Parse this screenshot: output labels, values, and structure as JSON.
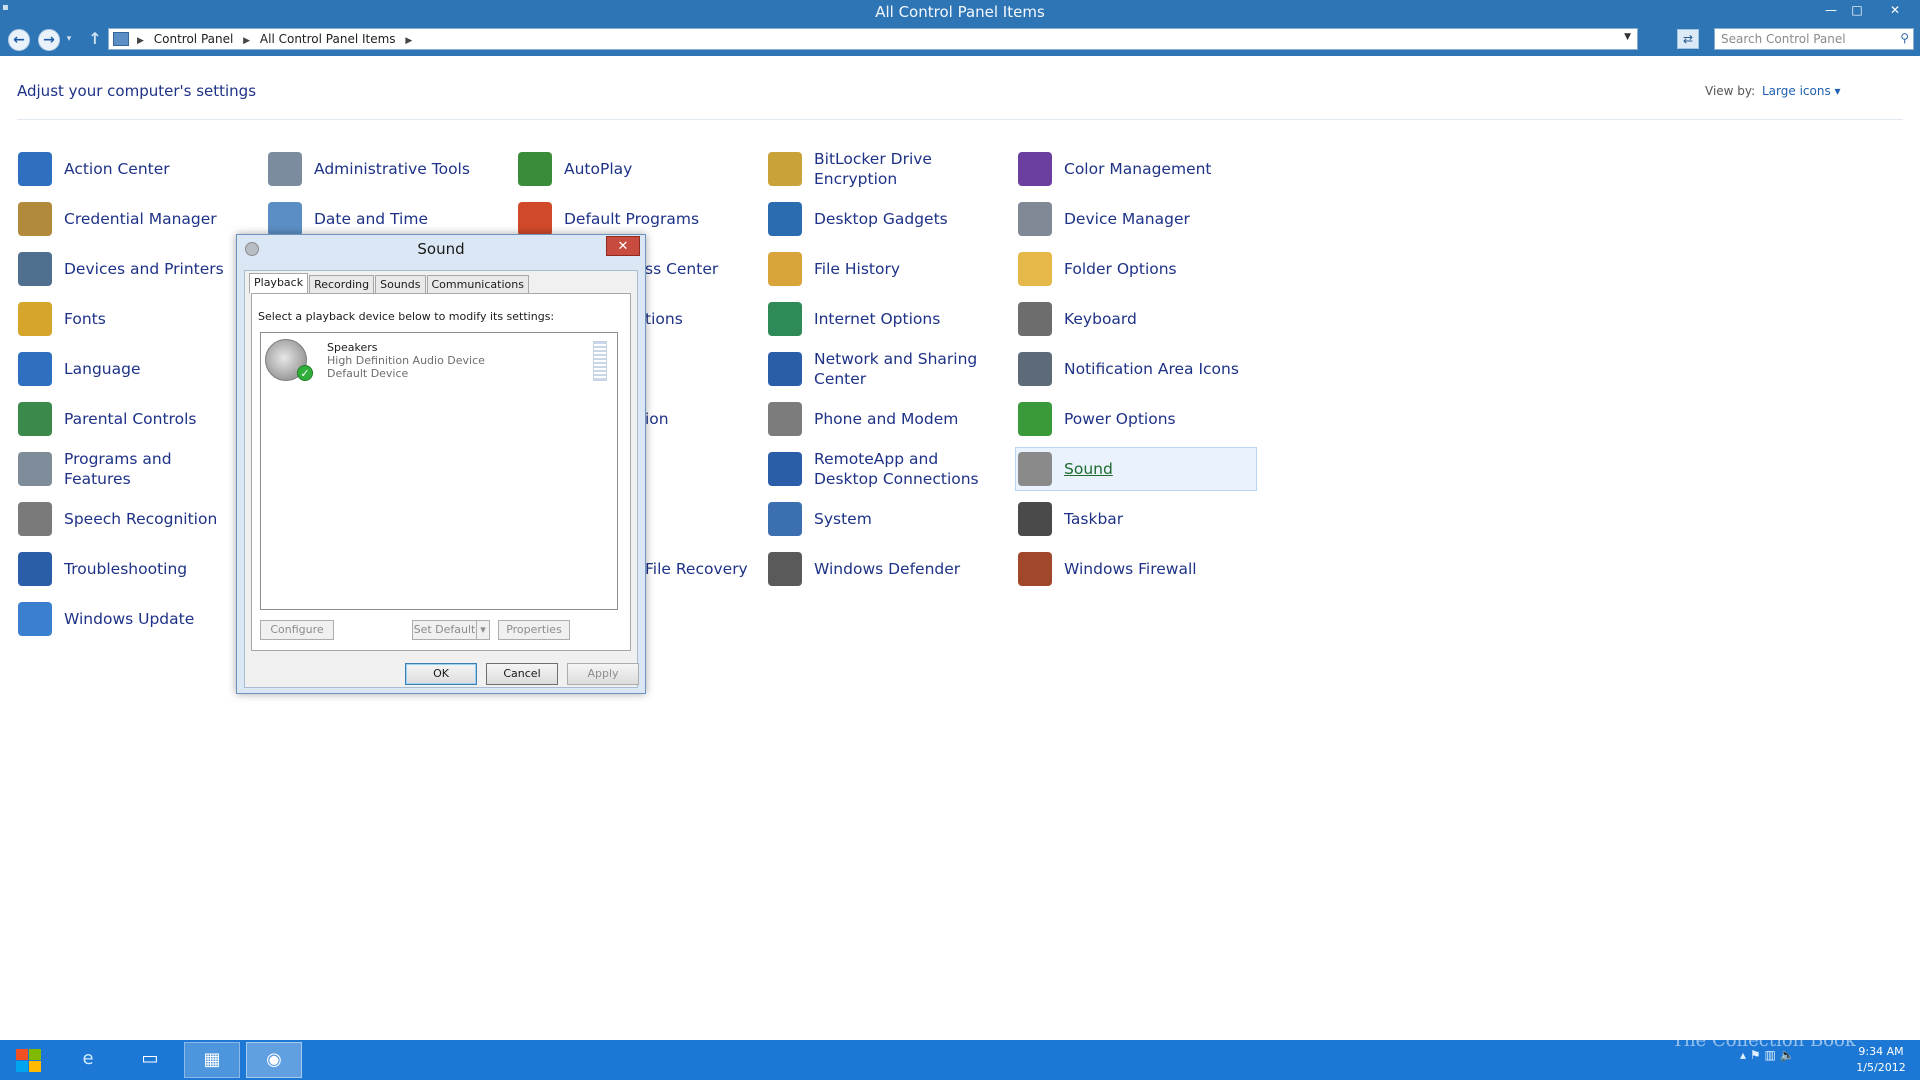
{
  "window": {
    "title": "All Control Panel Items",
    "minimize": "—",
    "maximize": "□",
    "close": "✕"
  },
  "address": {
    "crumbs": [
      "Control Panel",
      "All Control Panel Items"
    ],
    "search_placeholder": "Search Control Panel"
  },
  "header": {
    "title": "Adjust your computer's settings",
    "view_by_label": "View by:",
    "view_by_value": "Large icons ▾"
  },
  "items": [
    {
      "label": "Action Center",
      "icon": "flag-icon",
      "color": "#2f6fbf"
    },
    {
      "label": "Administrative Tools",
      "icon": "admin-tools-icon",
      "color": "#7a8c9e"
    },
    {
      "label": "AutoPlay",
      "icon": "autoplay-icon",
      "color": "#3a8c3a"
    },
    {
      "label": "BitLocker Drive Encryption",
      "icon": "bitlocker-key-icon",
      "color": "#c9a23a"
    },
    {
      "label": "Color Management",
      "icon": "color-management-icon",
      "color": "#6b3fa0"
    },
    {
      "label": "Credential Manager",
      "icon": "credential-vault-icon",
      "color": "#b28a3c"
    },
    {
      "label": "Date and Time",
      "icon": "calendar-clock-icon",
      "color": "#5b8ec4"
    },
    {
      "label": "Default Programs",
      "icon": "default-programs-icon",
      "color": "#d04a2a"
    },
    {
      "label": "Desktop Gadgets",
      "icon": "gadgets-icon",
      "color": "#2b6bb0"
    },
    {
      "label": "Device Manager",
      "icon": "device-manager-icon",
      "color": "#7f8a96"
    },
    {
      "label": "Devices and Printers",
      "icon": "printer-icon",
      "color": "#4f6f8f"
    },
    {
      "label": "ss Center",
      "icon": "ease-of-access-icon",
      "color": "#3a7bd5"
    },
    {
      "label": "File History",
      "icon": "file-history-icon",
      "color": "#d9a43a"
    },
    {
      "label": "Folder Options",
      "icon": "folder-options-icon",
      "color": "#e6b84a"
    },
    {
      "label": "Fonts",
      "icon": "fonts-icon",
      "color": "#d6a52c"
    },
    {
      "label": "tions",
      "icon": "generic-icon",
      "color": "#7aa0c8"
    },
    {
      "label": "Internet Options",
      "icon": "internet-globe-icon",
      "color": "#2f8a5a"
    },
    {
      "label": "Keyboard",
      "icon": "keyboard-icon",
      "color": "#6d6d6d"
    },
    {
      "label": "Language",
      "icon": "language-icon",
      "color": "#2f6fbf"
    },
    {
      "label": "Network and Sharing Center",
      "icon": "network-icon",
      "color": "#2b5ea8"
    },
    {
      "label": "Notification Area Icons",
      "icon": "notification-area-icon",
      "color": "#5d6b78"
    },
    {
      "label": "Parental Controls",
      "icon": "parental-controls-icon",
      "color": "#3b8a4c"
    },
    {
      "label": "ion",
      "icon": "generic-icon",
      "color": "#7aa0c8"
    },
    {
      "label": "Phone and Modem",
      "icon": "phone-modem-icon",
      "color": "#7c7c7c"
    },
    {
      "label": "Power Options",
      "icon": "power-options-icon",
      "color": "#3a9a3a"
    },
    {
      "label": "Programs and Features",
      "icon": "programs-features-icon",
      "color": "#7f8c9a"
    },
    {
      "label": "RemoteApp and Desktop Connections",
      "icon": "remoteapp-icon",
      "color": "#2b5ea8"
    },
    {
      "label": "Sound",
      "icon": "speaker-icon",
      "color": "#8a8a8a"
    },
    {
      "label": "Speech Recognition",
      "icon": "microphone-icon",
      "color": "#7a7a7a"
    },
    {
      "label": "System",
      "icon": "system-icon",
      "color": "#3b6fb0"
    },
    {
      "label": "Taskbar",
      "icon": "taskbar-icon",
      "color": "#4a4a4a"
    },
    {
      "label": "Troubleshooting",
      "icon": "troubleshooting-icon",
      "color": "#2b5ea8"
    },
    {
      "label": "File Recovery",
      "icon": "file-recovery-icon",
      "color": "#7aa0c8"
    },
    {
      "label": "Windows Defender",
      "icon": "defender-wall-icon",
      "color": "#5a5a5a"
    },
    {
      "label": "Windows Firewall",
      "icon": "firewall-icon",
      "color": "#a0472c"
    },
    {
      "label": "Windows Update",
      "icon": "windows-update-icon",
      "color": "#3b7fd0"
    }
  ],
  "dialog": {
    "title": "Sound",
    "close": "✕",
    "tabs": [
      "Playback",
      "Recording",
      "Sounds",
      "Communications"
    ],
    "instruction": "Select a playback device below to modify its settings:",
    "device": {
      "name": "Speakers",
      "line1": "High Definition Audio Device",
      "line2": "Default Device"
    },
    "buttons": {
      "configure": "Configure",
      "set_default": "Set Default",
      "properties": "Properties",
      "ok": "OK",
      "cancel": "Cancel",
      "apply": "Apply"
    }
  },
  "taskbar": {
    "time": "9:34 AM",
    "date": "1/5/2012",
    "watermark": "The Collection Book"
  }
}
